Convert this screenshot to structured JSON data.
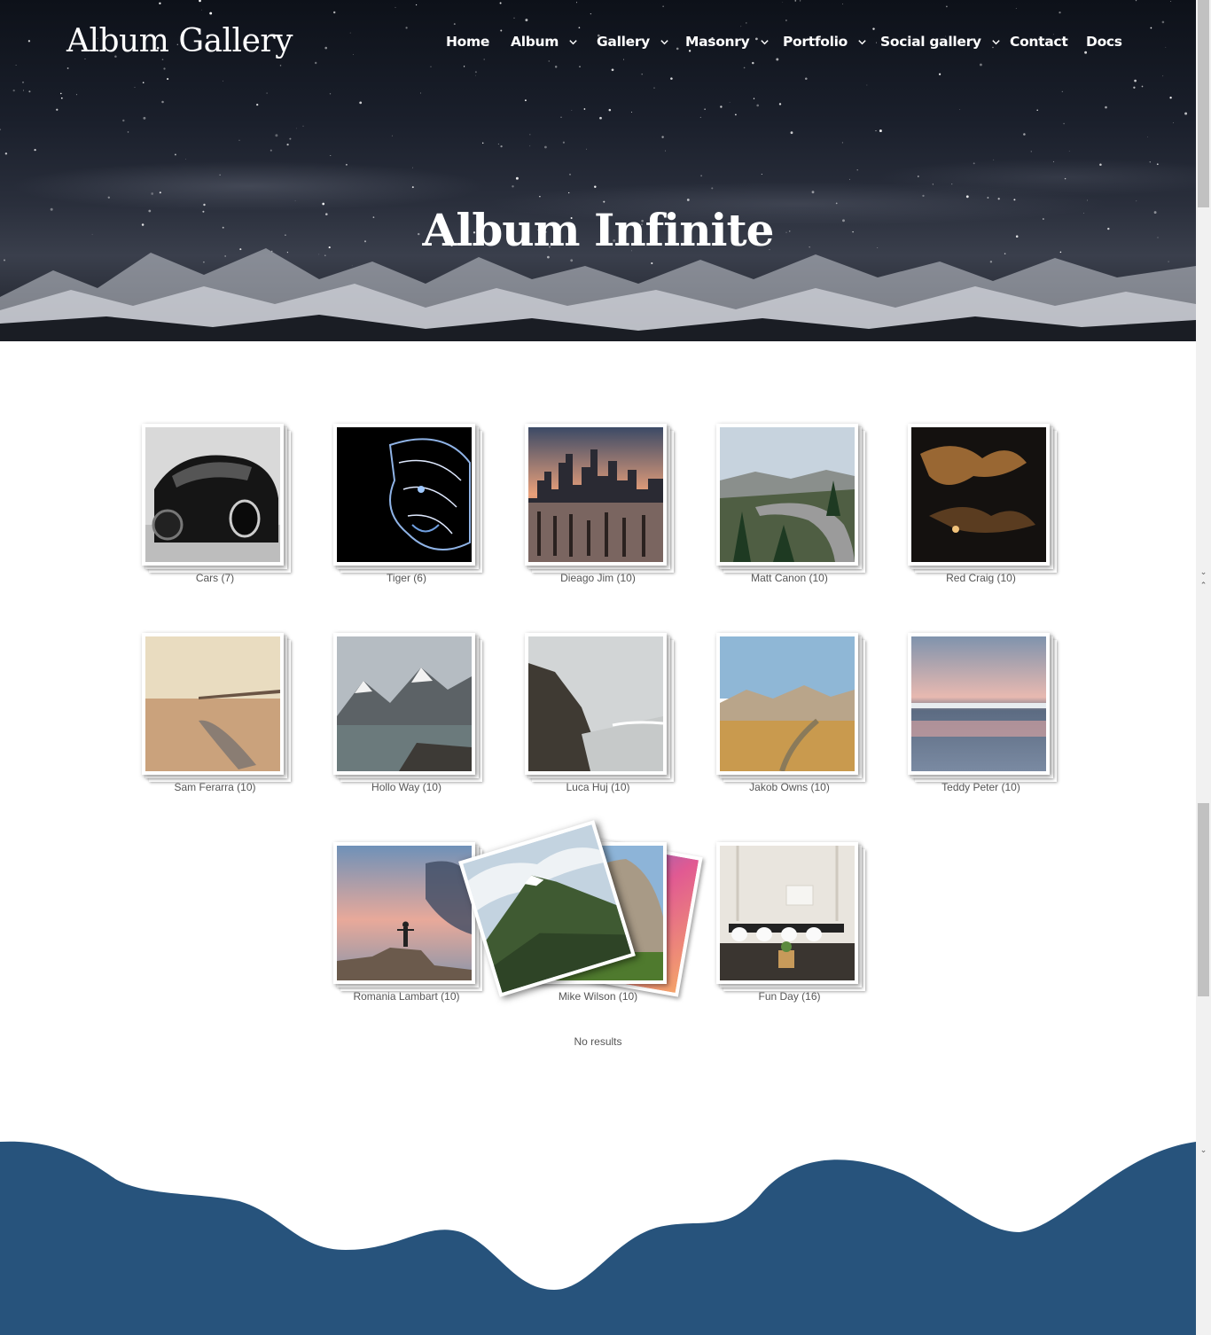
{
  "site": {
    "logo": "Album Gallery",
    "hero_title": "Album Infinite"
  },
  "nav": {
    "items": [
      {
        "label": "Home",
        "has_dropdown": false
      },
      {
        "label": "Album",
        "has_dropdown": true
      },
      {
        "label": "Gallery",
        "has_dropdown": true
      },
      {
        "label": "Masonry",
        "has_dropdown": true
      },
      {
        "label": "Portfolio",
        "has_dropdown": true
      },
      {
        "label": "Social gallery",
        "has_dropdown": true
      },
      {
        "label": "Contact",
        "has_dropdown": false
      },
      {
        "label": "Docs",
        "has_dropdown": false
      }
    ]
  },
  "albums": [
    {
      "caption": "Cars (7)",
      "icon": "car-photo"
    },
    {
      "caption": "Tiger (6)",
      "icon": "tiger-photo"
    },
    {
      "caption": "Dieago Jim (10)",
      "icon": "city-skyline-photo"
    },
    {
      "caption": "Matt Canon (10)",
      "icon": "mountain-road-photo"
    },
    {
      "caption": "Red Craig (10)",
      "icon": "dark-clouds-photo"
    },
    {
      "caption": "Sam Ferarra (10)",
      "icon": "beach-boat-photo"
    },
    {
      "caption": "Hollo Way (10)",
      "icon": "lake-mountains-photo"
    },
    {
      "caption": "Luca Huj (10)",
      "icon": "coast-rocks-photo"
    },
    {
      "caption": "Jakob Owns (10)",
      "icon": "desert-hills-photo"
    },
    {
      "caption": "Teddy Peter (10)",
      "icon": "sunset-sea-photo"
    },
    {
      "caption": "Romania Lambart (10)",
      "icon": "person-rock-photo"
    },
    {
      "caption": "Mike Wilson (10)",
      "icon": "mountain-forest-photo"
    },
    {
      "caption": "Fun Day (16)",
      "icon": "dining-room-photo"
    }
  ],
  "status": {
    "no_results": "No results"
  },
  "colors": {
    "footer_wave": "#27537c",
    "caption_text": "#555555"
  }
}
